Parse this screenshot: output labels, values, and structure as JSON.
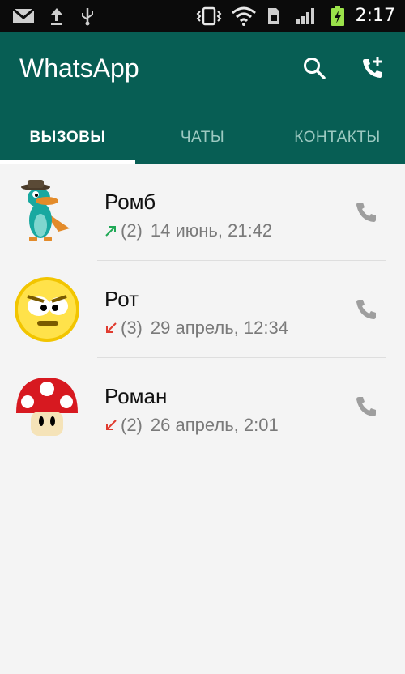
{
  "status_bar": {
    "time": "2:17",
    "icons": [
      "gmail-icon",
      "upload-icon",
      "usb-icon",
      "vibrate-icon",
      "wifi-icon",
      "sim-icon",
      "signal-icon",
      "battery-charging-icon"
    ]
  },
  "app_bar": {
    "title": "WhatsApp",
    "background_color": "#075e54",
    "actions": [
      "search-icon",
      "add-call-icon"
    ]
  },
  "tabs": [
    {
      "label": "ВЫЗОВЫ",
      "active": true
    },
    {
      "label": "ЧАТЫ",
      "active": false
    },
    {
      "label": "КОНТАКТЫ",
      "active": false
    }
  ],
  "calls": [
    {
      "name": "Ромб",
      "direction": "outgoing",
      "count": "(2)",
      "datetime": "14 июнь, 21:42",
      "avatar": "platypus-avatar",
      "arrow_color": "#1fa855"
    },
    {
      "name": "Рот",
      "direction": "missed",
      "count": "(3)",
      "datetime": "29 апрель, 12:34",
      "avatar": "smiley-avatar",
      "arrow_color": "#e03b2f"
    },
    {
      "name": "Роман",
      "direction": "missed",
      "count": "(2)",
      "datetime": "26 апрель, 2:01",
      "avatar": "mushroom-avatar",
      "arrow_color": "#e03b2f"
    }
  ]
}
